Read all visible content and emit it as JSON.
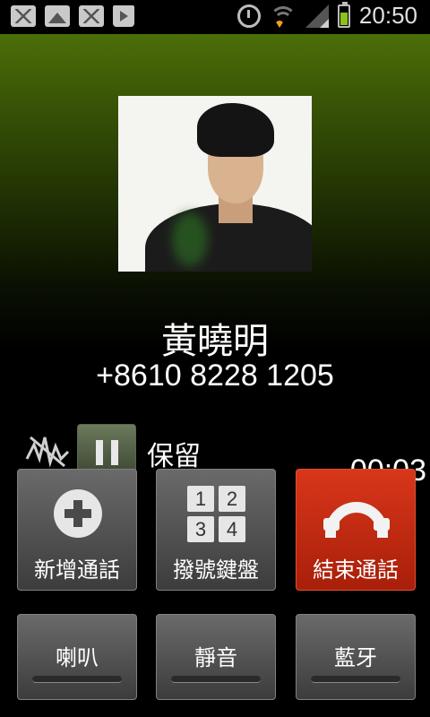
{
  "status_bar": {
    "icons": [
      "gmail-icon",
      "gmail-icon",
      "gallery-icon",
      "play-store-icon",
      "alarm-icon",
      "wifi-icon",
      "signal-icon",
      "battery-icon"
    ],
    "time": "20:50"
  },
  "caller": {
    "name": "黃曉明",
    "number": "+8610 8228 1205"
  },
  "call": {
    "hold_label": "保留",
    "duration": "00:03"
  },
  "actions": {
    "add_call": "新增通話",
    "keypad": "撥號鍵盤",
    "end_call": "結束通話",
    "keypad_keys": [
      "1",
      "2",
      "3",
      "4"
    ]
  },
  "toggles": {
    "speaker": "喇叭",
    "mute": "靜音",
    "bluetooth": "藍牙"
  },
  "colors": {
    "accent_green": "#4c6e08",
    "end_call_red": "#c22a12",
    "battery_green": "#8cc21b"
  }
}
